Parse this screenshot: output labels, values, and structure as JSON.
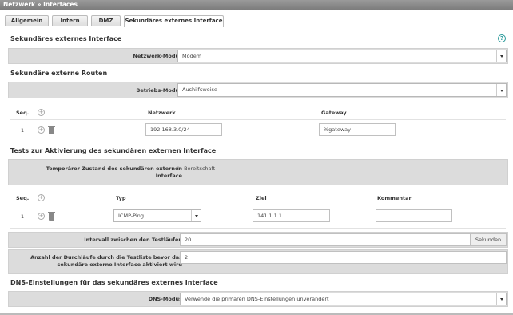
{
  "breadcrumb": "Netzwerk » Interfaces",
  "tabs": [
    "Allgemein",
    "Intern",
    "DMZ",
    "Sekundäres externes Interface"
  ],
  "section1": {
    "title": "Sekundäres externes Interface",
    "netzwerk_modus_label": "Netzwerk-Modus",
    "netzwerk_modus_value": "Modem"
  },
  "section2": {
    "title": "Sekundäre externe Routen",
    "betriebs_modus_label": "Betriebs-Modus",
    "betriebs_modus_value": "Aushilfsweise",
    "col_seq": "Seq.",
    "col_netzwerk": "Netzwerk",
    "col_gateway": "Gateway",
    "rows": [
      {
        "seq": "1",
        "netzwerk": "192.168.3.0/24",
        "gateway": "%gateway"
      }
    ]
  },
  "section3": {
    "title": "Tests zur Aktivierung des sekundären externen Interface",
    "zustand_label_1": "Temporärer Zustand des sekundären externen",
    "zustand_label_2": "Interface",
    "zustand_value": "In Bereitschaft",
    "col_seq": "Seq.",
    "col_typ": "Typ",
    "col_ziel": "Ziel",
    "col_kommentar": "Kommentar",
    "rows": [
      {
        "seq": "1",
        "typ": "ICMP-Ping",
        "ziel": "141.1.1.1",
        "kommentar": ""
      }
    ],
    "intervall_label": "Intervall zwischen den Testläufen",
    "intervall_value": "20",
    "intervall_unit": "Sekunden",
    "durchlaeufe_label_1": "Anzahl der Durchläufe durch die Testliste bevor das",
    "durchlaeufe_label_2": "sekundäre externe Interface aktiviert wird",
    "durchlaeufe_value": "2"
  },
  "section4": {
    "title": "DNS-Einstellungen für das sekundäres externes Interface",
    "dns_label": "DNS-Modus",
    "dns_value": "Verwende die primären DNS-Einstellungen unverändert"
  }
}
